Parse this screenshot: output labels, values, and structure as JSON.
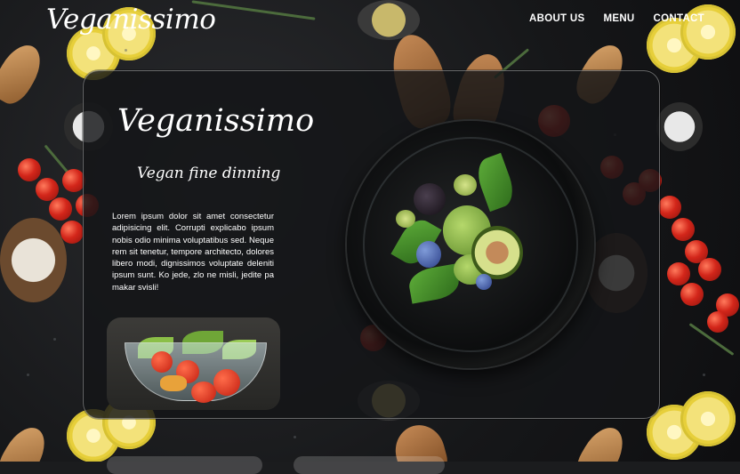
{
  "brand": {
    "name": "Veganissimo"
  },
  "nav": {
    "items": [
      "ABOUT US",
      "MENU",
      "CONTACT"
    ]
  },
  "hero": {
    "title": "Veganissimo",
    "subtitle": "Vegan fine dinning",
    "description": "Lorem ipsum dolor sit amet consectetur adipisicing elit. Corrupti explicabo ipsum nobis odio minima voluptatibus sed. Neque rem sit tenetur, tempore architecto, dolores libero modi, dignissimos voluptate deleniti ipsum sunt. Ko jede, zlo ne misli, jedite pa makar svisli!"
  },
  "colors": {
    "background": "#1b1c1e",
    "text": "#ffffff",
    "card_border": "#8a8c8f"
  }
}
